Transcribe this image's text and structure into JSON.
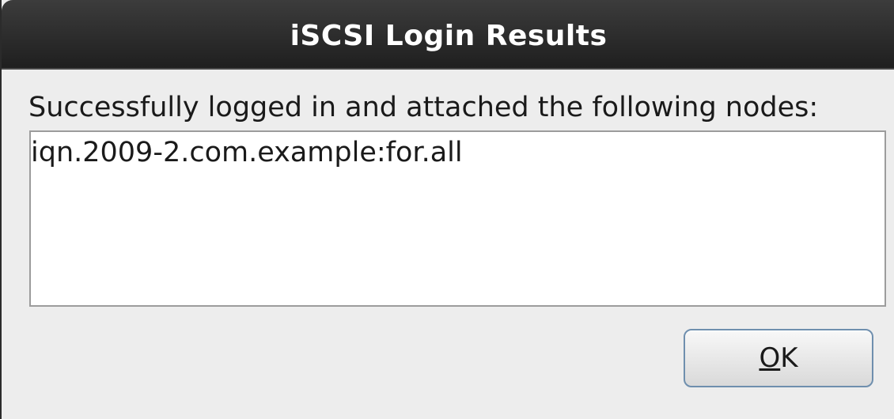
{
  "dialog": {
    "title": "iSCSI Login Results",
    "message": "Successfully logged in and attached the following nodes:",
    "nodes": [
      "iqn.2009-2.com.example:for.all"
    ],
    "ok_button": {
      "mnemonic": "O",
      "rest": "K"
    }
  },
  "colors": {
    "titlebar": "#2b2b2b",
    "title_text": "#ffffff",
    "dialog_bg": "#ededed",
    "button_border": "#6f8fae"
  }
}
